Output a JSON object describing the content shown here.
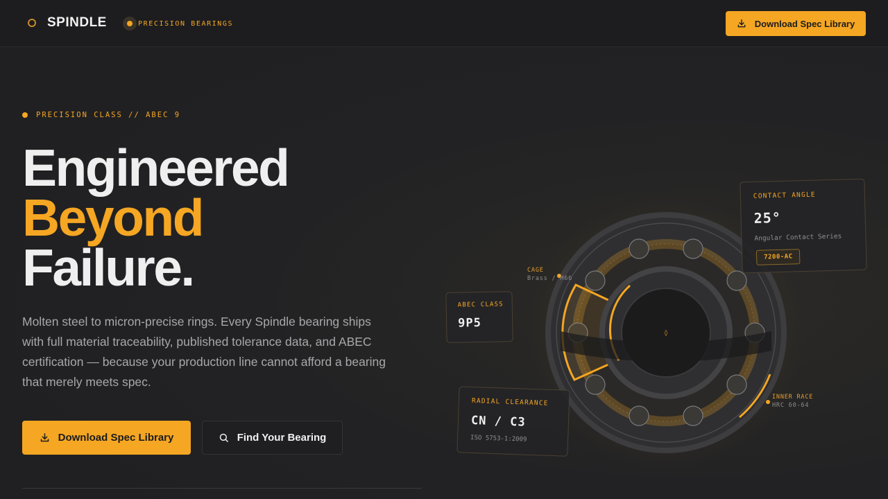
{
  "header": {
    "brand": "SPINDLE",
    "tagline": "PRECISION BEARINGS",
    "cta_label": "Download Spec Library"
  },
  "hero": {
    "eyebrow": "PRECISION CLASS // ABEC 9",
    "headline_line1": "Engineered",
    "headline_line2": "Beyond",
    "headline_line3": "Failure.",
    "lede": "Molten steel to micron-precise rings. Every Spindle bearing ships with full material traceability, published tolerance data, and ABEC certification — because your production line cannot afford a bearing that merely meets spec.",
    "primary_cta": "Download Spec Library",
    "secondary_cta": "Find Your Bearing"
  },
  "diagram": {
    "contact_angle": {
      "label": "CONTACT ANGLE",
      "value": "25°",
      "note": "Angular Contact Series",
      "chip": "7200-AC"
    },
    "abec_class": {
      "label": "ABEC CLASS",
      "value": "9P5"
    },
    "radial_clearance": {
      "label": "RADIAL CLEARANCE",
      "value": "CN / C3",
      "note": "ISO 5753-1:2009"
    },
    "cage": {
      "label": "CAGE",
      "note": "Brass / M66"
    },
    "inner_race": {
      "label": "INNER RACE",
      "note": "HRC 60-64"
    },
    "center_glyph": "◊"
  },
  "colors": {
    "accent": "#f5a623",
    "background": "#222224",
    "text": "#efefef",
    "muted": "#a8a8aa"
  },
  "icons": {
    "download": "download-icon",
    "search": "search-icon",
    "brand": "brand-ring-icon"
  }
}
